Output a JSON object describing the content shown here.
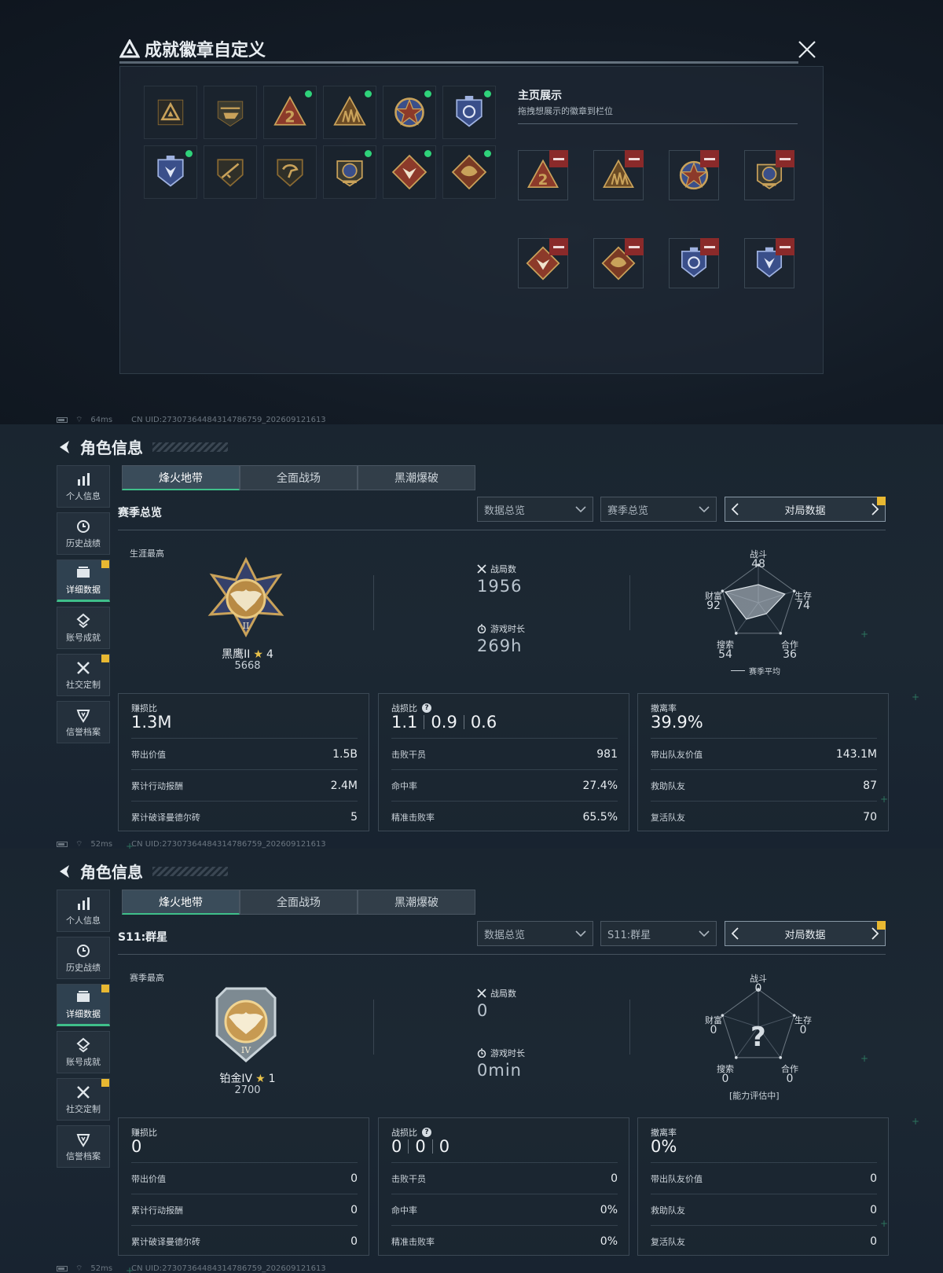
{
  "modal": {
    "title": "成就徽章自定义",
    "showcase_title": "主页展示",
    "showcase_sub": "拖拽想展示的徽章到栏位",
    "badges": [
      {
        "icon": "triangle-emblem-icon",
        "new": false
      },
      {
        "icon": "helicopter-badge-icon",
        "new": false
      },
      {
        "icon": "number-2-badge-icon",
        "new": true
      },
      {
        "icon": "soldiers-badge-icon",
        "new": true
      },
      {
        "icon": "star-medal-icon",
        "new": true
      },
      {
        "icon": "blue-shield-badge-icon",
        "new": true
      },
      {
        "icon": "blue-wolf-shield-icon",
        "new": true
      },
      {
        "icon": "rifle-shield-icon",
        "new": false
      },
      {
        "icon": "hand-shield-icon",
        "new": false
      },
      {
        "icon": "wreath-medal-icon",
        "new": true
      },
      {
        "icon": "wolf-diamond-icon",
        "new": true
      },
      {
        "icon": "dragon-diamond-icon",
        "new": true
      }
    ],
    "slots": [
      {
        "icon": "number-2-badge-icon"
      },
      {
        "icon": "soldiers-badge-icon"
      },
      {
        "icon": "star-medal-icon"
      },
      {
        "icon": "wreath-medal-icon"
      },
      {
        "icon": "wolf-diamond-icon"
      },
      {
        "icon": "dragon-diamond-icon"
      },
      {
        "icon": "blue-shield-badge-icon"
      },
      {
        "icon": "blue-wolf-shield-icon"
      }
    ]
  },
  "status": [
    {
      "ping": "64ms",
      "uid": "CN UID:273073644843147867​59_202609121613"
    },
    {
      "ping": "52ms",
      "uid": "CN UID:27307364484314786759_202609121613"
    },
    {
      "ping": "52ms",
      "uid": "CN UID:27307364484314786759_202609121613"
    }
  ],
  "profile_common": {
    "header": "角色信息",
    "side": [
      "个人信息",
      "历史战绩",
      "详细数据",
      "账号成就",
      "社交定制",
      "信誉档案"
    ],
    "tabs": [
      "烽火地带",
      "全面战场",
      "黑潮爆破"
    ],
    "dd_a": "数据总览",
    "pager": "对局数据",
    "lbl_games": "战局数",
    "lbl_time": "游戏时长",
    "radar": {
      "combat": "战斗",
      "survive": "生存",
      "coop": "合作",
      "search": "搜索",
      "wealth": "财富"
    },
    "p1_head": "赚损比",
    "p1_k1": "带出价值",
    "p1_k2": "累计行动报酬",
    "p1_k3": "累计破译曼德尔砖",
    "p2_head": "战损比",
    "p2_k1": "击败干员",
    "p2_k2": "命中率",
    "p2_k3": "精准击败率",
    "p3_head": "撤离率",
    "p3_k1": "带出队友价值",
    "p3_k2": "救助队友",
    "p3_k3": "复活队友"
  },
  "profile1": {
    "section_title": "赛季总览",
    "dd_b": "赛季总览",
    "best_label": "生涯最高",
    "rank_name": "黑鹰II",
    "stars": "4",
    "points": "5668",
    "games": "1956",
    "time": "269h",
    "radar_vals": {
      "combat": "48",
      "survive": "74",
      "coop": "36",
      "search": "54",
      "wealth": "92"
    },
    "radar_caption": "赛季平均",
    "p1_val": "1.3M",
    "p1_v1": "1.5B",
    "p1_v2": "2.4M",
    "p1_v3": "5",
    "p2_vals": [
      "1.1",
      "0.9",
      "0.6"
    ],
    "p2_v1": "981",
    "p2_v2": "27.4%",
    "p2_v3": "65.5%",
    "p3_val": "39.9%",
    "p3_v1": "143.1M",
    "p3_v2": "87",
    "p3_v3": "70"
  },
  "profile2": {
    "section_title": "S11:群星",
    "dd_b": "S11:群星",
    "best_label": "赛季最高",
    "rank_name": "铂金IV",
    "stars": "1",
    "points": "2700",
    "games": "0",
    "time": "0min",
    "radar_vals": {
      "combat": "0",
      "survive": "0",
      "coop": "0",
      "search": "0",
      "wealth": "0"
    },
    "radar_caption": "[能力评估中]",
    "p1_val": "0",
    "p1_v1": "0",
    "p1_v2": "0",
    "p1_v3": "0",
    "p2_vals": [
      "0",
      "0",
      "0"
    ],
    "p2_v1": "0",
    "p2_v2": "0%",
    "p2_v3": "0%",
    "p3_val": "0%",
    "p3_v1": "0",
    "p3_v2": "0",
    "p3_v3": "0"
  },
  "colors": {
    "accent": "#3fbf8a",
    "new_dot": "#2fd27a",
    "flag": "#e8b832",
    "remove": "#8a2a2a"
  }
}
